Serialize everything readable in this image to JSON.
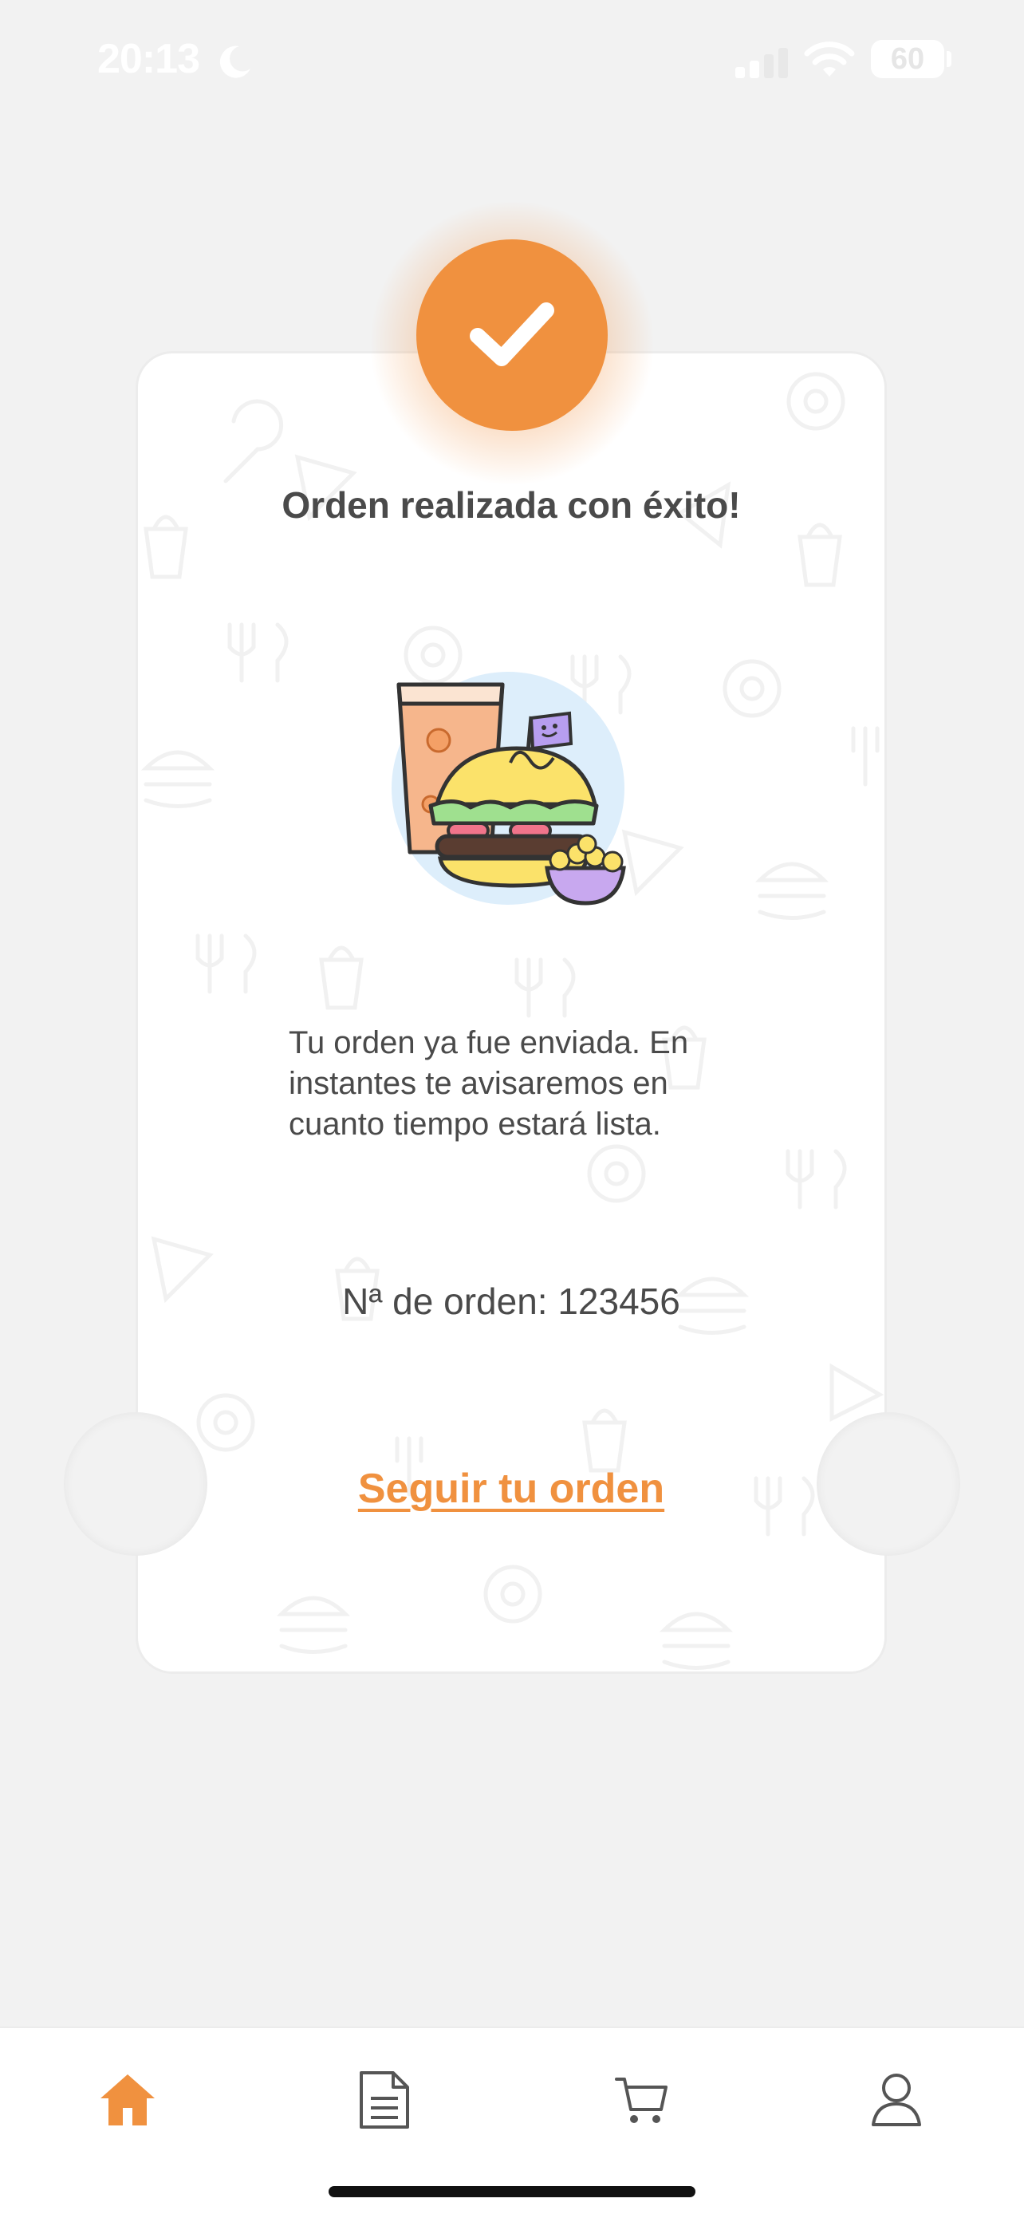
{
  "status_bar": {
    "time": "20:13",
    "battery": "60",
    "moon_icon": "moon-icon",
    "signal_icon": "cellular-signal-icon",
    "wifi_icon": "wifi-icon"
  },
  "ticket": {
    "title": "Orden realizada con éxito!",
    "message": "Tu orden ya fue enviada. En instantes te avisaremos en cuanto tiempo estará lista.",
    "order_number": "Nª de orden: 123456",
    "track_link": "Seguir tu orden",
    "badge_icon": "checkmark-icon",
    "illustration": "burger-meal-illustration"
  },
  "bottom_nav": {
    "items": [
      {
        "icon": "home-icon",
        "active": true
      },
      {
        "icon": "document-icon",
        "active": false
      },
      {
        "icon": "cart-icon",
        "active": false
      },
      {
        "icon": "user-icon",
        "active": false
      }
    ]
  },
  "colors": {
    "accent": "#f0913f",
    "text": "#4a4a4a",
    "background": "#f2f2f2",
    "card": "#ffffff"
  }
}
